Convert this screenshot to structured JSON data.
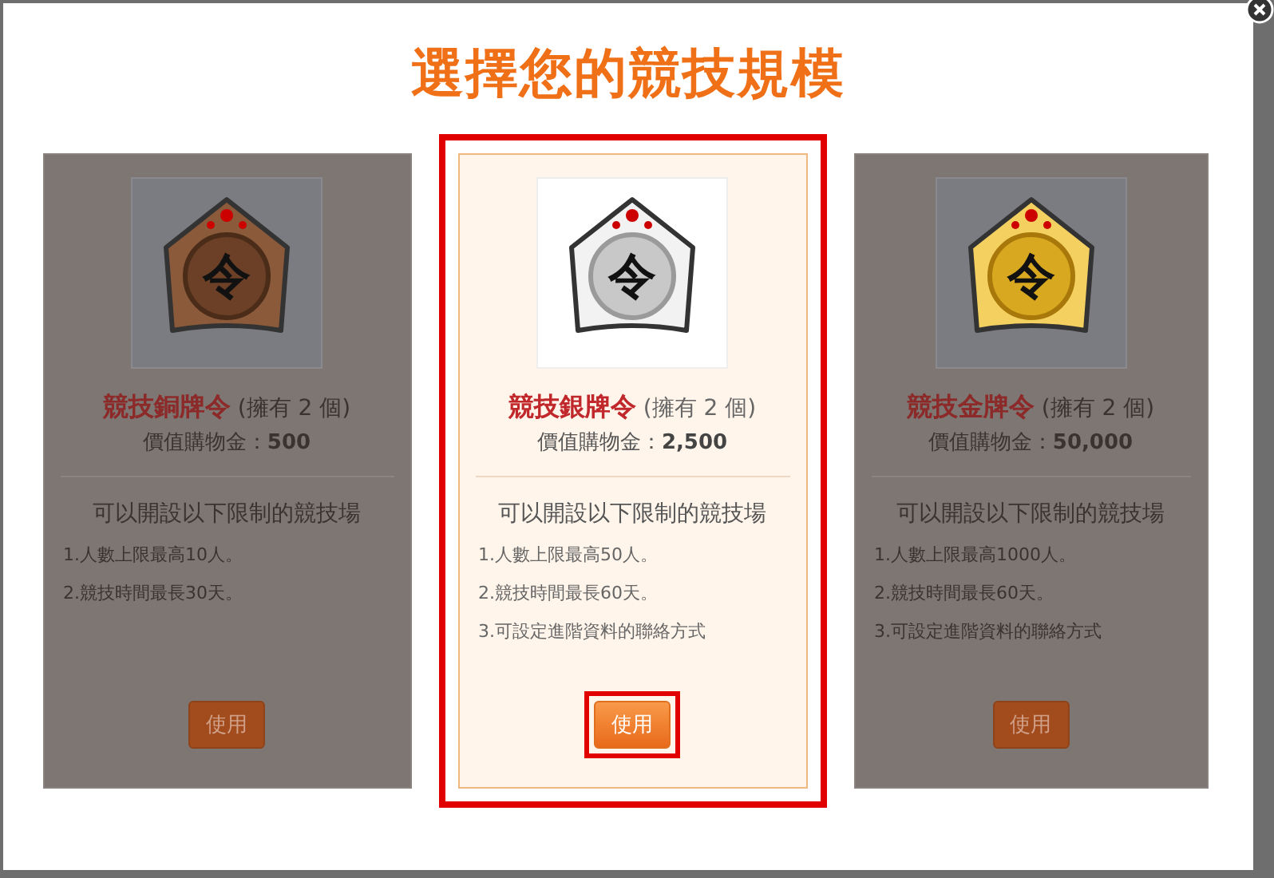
{
  "title": "選擇您的競技規模",
  "cards": [
    {
      "kind": "bronze",
      "selected": false,
      "emblem": "令",
      "name": "競技銅牌令",
      "owned": "(擁有 2 個)",
      "value": "價值購物金：**500**",
      "heading": "可以開設以下限制的競技場",
      "rules": [
        "1.人數上限最高10人。",
        "2.競技時間最長30天。"
      ],
      "button": "使用"
    },
    {
      "kind": "silver",
      "selected": true,
      "emblem": "令",
      "name": "競技銀牌令",
      "owned": "(擁有 2 個)",
      "value": "價值購物金：**2,500**",
      "heading": "可以開設以下限制的競技場",
      "rules": [
        "1.人數上限最高50人。",
        "2.競技時間最長60天。",
        "3.可設定進階資料的聯絡方式"
      ],
      "button": "使用"
    },
    {
      "kind": "gold",
      "selected": false,
      "emblem": "令",
      "name": "競技金牌令",
      "owned": "(擁有 2 個)",
      "value": "價值購物金：**50,000**",
      "heading": "可以開設以下限制的競技場",
      "rules": [
        "1.人數上限最高1000人。",
        "2.競技時間最長60天。",
        "3.可設定進階資料的聯絡方式"
      ],
      "button": "使用"
    }
  ]
}
